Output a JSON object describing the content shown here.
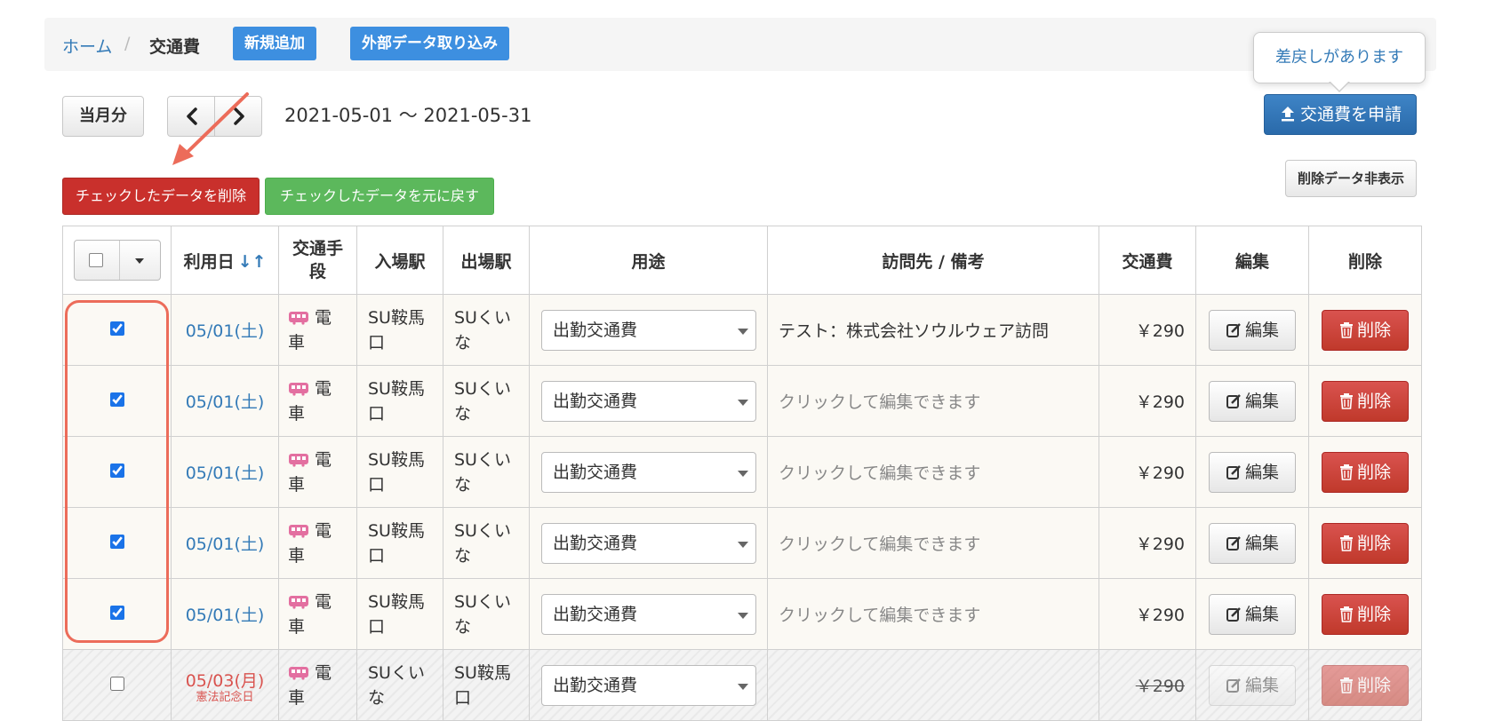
{
  "breadcrumb": {
    "home": "ホーム",
    "separator": "/",
    "current": "交通費"
  },
  "top_buttons": {
    "add_new": "新規追加",
    "import": "外部データ取り込み"
  },
  "period": {
    "this_month": "当月分",
    "range": "2021-05-01 〜 2021-05-31"
  },
  "tooltip": "差戻しがあります",
  "apply_button": "交通費を申請",
  "bulk_actions": {
    "delete_checked": "チェックしたデータを削除",
    "restore_checked": "チェックしたデータを元に戻す"
  },
  "hide_deleted": "削除データ非表示",
  "table": {
    "headers": {
      "date": "利用日",
      "transport_l1": "交通手",
      "transport_l2": "段",
      "entry": "入場駅",
      "exit": "出場駅",
      "purpose": "用途",
      "memo": "訪問先 / 備考",
      "fare": "交通費",
      "edit": "編集",
      "delete": "削除"
    },
    "rows": [
      {
        "checked": true,
        "date": "05/01(土)",
        "transport_a": "電",
        "transport_b": "車",
        "entry_a": "SU鞍馬",
        "entry_b": "口",
        "exit_a": "SUくい",
        "exit_b": "な",
        "purpose": "出勤交通費",
        "memo": "テスト：株式会社ソウルウェア訪問",
        "fare": "￥290",
        "edit": "編集",
        "delete": "削除"
      },
      {
        "checked": true,
        "date": "05/01(土)",
        "transport_a": "電",
        "transport_b": "車",
        "entry_a": "SU鞍馬",
        "entry_b": "口",
        "exit_a": "SUくい",
        "exit_b": "な",
        "purpose": "出勤交通費",
        "memo": "クリックして編集できます",
        "fare": "￥290",
        "edit": "編集",
        "delete": "削除"
      },
      {
        "checked": true,
        "date": "05/01(土)",
        "transport_a": "電",
        "transport_b": "車",
        "entry_a": "SU鞍馬",
        "entry_b": "口",
        "exit_a": "SUくい",
        "exit_b": "な",
        "purpose": "出勤交通費",
        "memo": "クリックして編集できます",
        "fare": "￥290",
        "edit": "編集",
        "delete": "削除"
      },
      {
        "checked": true,
        "date": "05/01(土)",
        "transport_a": "電",
        "transport_b": "車",
        "entry_a": "SU鞍馬",
        "entry_b": "口",
        "exit_a": "SUくい",
        "exit_b": "な",
        "purpose": "出勤交通費",
        "memo": "クリックして編集できます",
        "fare": "￥290",
        "edit": "編集",
        "delete": "削除"
      },
      {
        "checked": true,
        "date": "05/01(土)",
        "transport_a": "電",
        "transport_b": "車",
        "entry_a": "SU鞍馬",
        "entry_b": "口",
        "exit_a": "SUくい",
        "exit_b": "な",
        "purpose": "出勤交通費",
        "memo": "クリックして編集できます",
        "fare": "￥290",
        "edit": "編集",
        "delete": "削除"
      },
      {
        "checked": false,
        "date": "05/03(月)",
        "holiday": "憲法記念日",
        "transport_a": "電",
        "transport_b": "車",
        "entry_a": "SUくい",
        "entry_b": "な",
        "exit_a": "SU鞍馬",
        "exit_b": "口",
        "purpose": "出勤交通費",
        "memo": "",
        "fare": "￥290",
        "edit": "編集",
        "delete": "削除"
      }
    ]
  },
  "colors": {
    "accent": "#337ab7",
    "danger": "#c9302c",
    "success": "#5cb85c",
    "annotation": "#ec6c5a"
  }
}
